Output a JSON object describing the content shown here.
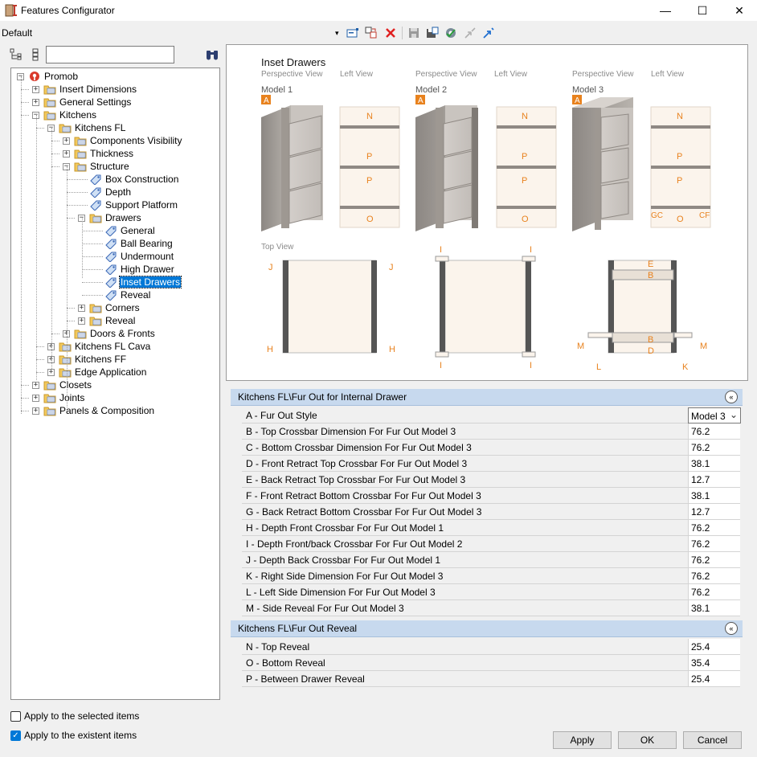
{
  "window": {
    "title": "Features Configurator",
    "minimize": "—",
    "maximize": "☐",
    "close": "✕"
  },
  "profile": {
    "label": "Default",
    "dropdown_arrow": "▾"
  },
  "search": {
    "placeholder": ""
  },
  "tree": [
    {
      "label": "Promob",
      "expander": "−",
      "icon": "promob-logo-icon"
    },
    {
      "label": "Insert Dimensions",
      "expander": "+",
      "icon": "folder-icon"
    },
    {
      "label": "General Settings",
      "expander": "+",
      "icon": "folder-icon"
    },
    {
      "label": "Kitchens",
      "expander": "−",
      "icon": "folder-icon"
    },
    {
      "label": "Kitchens FL",
      "expander": "−",
      "icon": "folder-icon"
    },
    {
      "label": "Components Visibility",
      "expander": "+",
      "icon": "folder-icon"
    },
    {
      "label": "Thickness",
      "expander": "+",
      "icon": "folder-icon"
    },
    {
      "label": "Structure",
      "expander": "−",
      "icon": "folder-icon"
    },
    {
      "label": "Box Construction",
      "expander": "",
      "icon": "tag-icon"
    },
    {
      "label": "Depth",
      "expander": "",
      "icon": "tag-icon"
    },
    {
      "label": "Support Platform",
      "expander": "",
      "icon": "tag-icon"
    },
    {
      "label": "Drawers",
      "expander": "−",
      "icon": "folder-icon"
    },
    {
      "label": "General",
      "expander": "",
      "icon": "tag-icon"
    },
    {
      "label": "Ball Bearing",
      "expander": "",
      "icon": "tag-icon"
    },
    {
      "label": "Undermount",
      "expander": "",
      "icon": "tag-icon"
    },
    {
      "label": "High Drawer",
      "expander": "",
      "icon": "tag-icon"
    },
    {
      "label": "Inset Drawers",
      "expander": "",
      "icon": "tag-icon",
      "selected": true
    },
    {
      "label": "Reveal",
      "expander": "",
      "icon": "tag-icon"
    },
    {
      "label": "Corners",
      "expander": "+",
      "icon": "folder-icon"
    },
    {
      "label": "Reveal",
      "expander": "+",
      "icon": "folder-icon"
    },
    {
      "label": "Doors & Fronts",
      "expander": "+",
      "icon": "folder-icon"
    },
    {
      "label": "Kitchens FL Cava",
      "expander": "+",
      "icon": "folder-icon"
    },
    {
      "label": "Kitchens FF",
      "expander": "+",
      "icon": "folder-icon"
    },
    {
      "label": "Edge Application",
      "expander": "+",
      "icon": "folder-icon"
    },
    {
      "label": "Closets",
      "expander": "+",
      "icon": "folder-icon"
    },
    {
      "label": "Joints",
      "expander": "+",
      "icon": "folder-icon"
    },
    {
      "label": "Panels & Composition",
      "expander": "+",
      "icon": "folder-icon"
    }
  ],
  "preview": {
    "title": "Inset Drawers",
    "perspective_view": "Perspective  View",
    "left_view": "Left View",
    "top_view": "Top View",
    "models": [
      "Model 1",
      "Model 2",
      "Model 3"
    ],
    "marker": "A",
    "letters": {
      "N": "N",
      "P": "P",
      "O": "O",
      "GC": "GC",
      "CF": "CF",
      "I": "I",
      "J": "J",
      "H": "H",
      "E": "E",
      "B": "B",
      "D": "D",
      "M": "M",
      "L": "L",
      "K": "K"
    },
    "accent_color": "#e8821e"
  },
  "sections": [
    {
      "title": "Kitchens FL\\Fur Out for Internal Drawer",
      "collapse_icon": "«",
      "rows": [
        {
          "name": "A - Fur Out Style",
          "value": "Model 3",
          "dropdown": true,
          "arrow": "⌄"
        },
        {
          "name": "B - Top Crossbar Dimension For Fur Out Model 3",
          "value": "76.2"
        },
        {
          "name": "C - Bottom Crossbar Dimension For Fur Out Model 3",
          "value": "76.2"
        },
        {
          "name": "D - Front Retract Top Crossbar For Fur Out Model 3",
          "value": "38.1"
        },
        {
          "name": "E - Back Retract Top Crossbar For Fur Out Model 3",
          "value": "12.7"
        },
        {
          "name": "F - Front Retract Bottom Crossbar For Fur Out Model 3",
          "value": "38.1"
        },
        {
          "name": "G - Back Retract Bottom Crossbar For Fur Out Model 3",
          "value": "12.7"
        },
        {
          "name": "H - Depth Front Crossbar For Fur Out Model 1",
          "value": "76.2"
        },
        {
          "name": "I - Depth Front/back Crossbar For Fur Out Model 2",
          "value": "76.2"
        },
        {
          "name": "J - Depth Back Crossbar For Fur Out Model 1",
          "value": "76.2"
        },
        {
          "name": "K - Right Side Dimension For Fur Out Model 3",
          "value": "76.2"
        },
        {
          "name": "L - Left Side Dimension For Fur Out Model 3",
          "value": "76.2"
        },
        {
          "name": "M - Side Reveal For Fur Out Model 3",
          "value": "38.1"
        }
      ]
    },
    {
      "title": "Kitchens FL\\Fur Out Reveal",
      "collapse_icon": "«",
      "rows": [
        {
          "name": "N - Top Reveal",
          "value": "25.4"
        },
        {
          "name": "O - Bottom Reveal",
          "value": "35.4"
        },
        {
          "name": "P - Between Drawer Reveal",
          "value": "25.4"
        }
      ]
    }
  ],
  "options": [
    {
      "label": "Apply to the selected items",
      "checked": false,
      "mark": ""
    },
    {
      "label": "Apply to the existent items",
      "checked": true,
      "mark": "✓"
    }
  ],
  "buttons": {
    "apply": "Apply",
    "ok": "OK",
    "cancel": "Cancel"
  }
}
